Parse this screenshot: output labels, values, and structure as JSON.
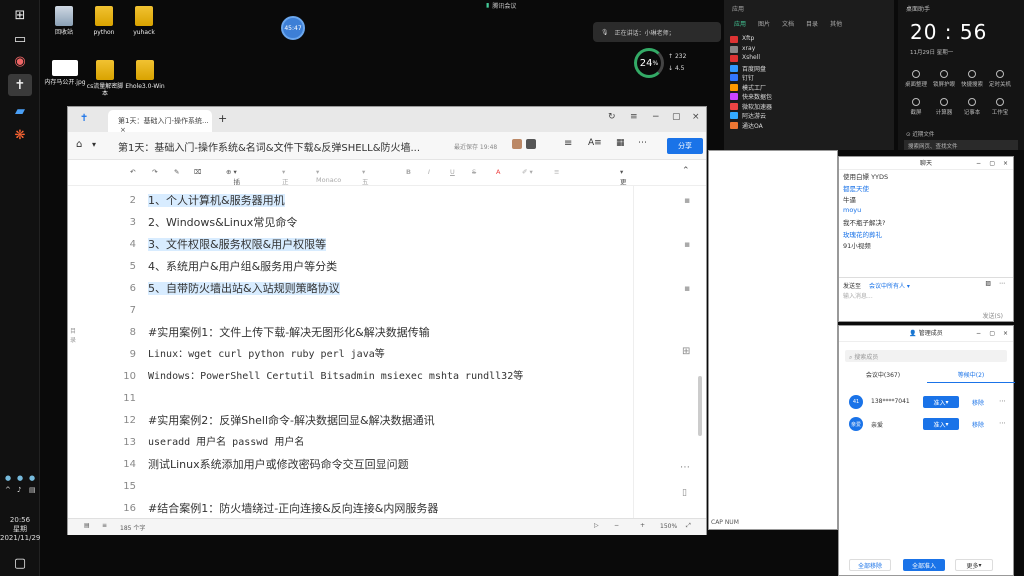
{
  "desktop": {
    "icons": [
      {
        "label": "回收站",
        "kind": "bin"
      },
      {
        "label": "python",
        "kind": "folder"
      },
      {
        "label": "yuhack",
        "kind": "folder"
      },
      {
        "label": "内存马公开.jpg",
        "kind": "image"
      },
      {
        "label": "cs流量解密脚本",
        "kind": "folder"
      },
      {
        "label": "Ehole3.0-Win",
        "kind": "folder"
      }
    ],
    "time_bubble": "45:47",
    "meeting_bar": "腾讯会议",
    "speaking_text": "正在讲话：小琳老师；",
    "net_speed": {
      "percent": "24",
      "unit": "%",
      "up": "232",
      "down": "4.5"
    }
  },
  "taskbar": {
    "clock_time": "20:56",
    "clock_day": "星期",
    "clock_date": "2021/11/29"
  },
  "applist": {
    "header": "应用",
    "tabs": [
      "应用",
      "图片",
      "文档",
      "目录",
      "其他"
    ],
    "items": [
      "Xftp",
      "xray",
      "Xshell",
      "百度网盘",
      "钉钉",
      "模式工厂",
      "快来数据包",
      "微软加速器",
      "阿达游云",
      "通达OA"
    ]
  },
  "control": {
    "title": "桌面助手",
    "time": "20 : 56",
    "date": "11月29日   星期一",
    "quick": [
      "桌面整理",
      "锁屏护眼",
      "快捷搜索",
      "定时关机",
      "截屏",
      "计算器",
      "记事本",
      "工作宝"
    ],
    "recent": "近期文件",
    "search": "搜索网页、查找文件"
  },
  "doc": {
    "tab_title": "第1天：基础入门-操作系统...",
    "title": "第1天：基础入门-操作系统&名词&文件下载&反弹SHELL&防火墙...",
    "saved": "最近保存 19:48",
    "share": "分享",
    "toolbar": [
      "插入",
      "正文",
      "Monaco",
      "五号",
      "B",
      "I",
      "U",
      "S",
      "A",
      "更多"
    ],
    "lines": [
      {
        "n": "2",
        "t": "1、个人计算机&服务器用机"
      },
      {
        "n": "3",
        "t": "2、Windows&Linux常见命令"
      },
      {
        "n": "4",
        "t": "3、文件权限&服务权限&用户权限等"
      },
      {
        "n": "5",
        "t": "4、系统用户&用户组&服务用户等分类"
      },
      {
        "n": "6",
        "t": "5、自带防火墙出站&入站规则策略协议"
      },
      {
        "n": "7",
        "t": ""
      },
      {
        "n": "8",
        "t": "#实用案例1：文件上传下载-解决无图形化&解决数据传输"
      },
      {
        "n": "9",
        "t": "Linux：wget curl python ruby perl java等"
      },
      {
        "n": "10",
        "t": "Windows：PowerShell Certutil Bitsadmin msiexec mshta rundll32等"
      },
      {
        "n": "11",
        "t": ""
      },
      {
        "n": "12",
        "t": "#实用案例2：反弹Shell命令-解决数据回显&解决数据通讯"
      },
      {
        "n": "13",
        "t": "useradd 用户名 passwd 用户名"
      },
      {
        "n": "14",
        "t": "测试Linux系统添加用户或修改密码命令交互回显问题"
      },
      {
        "n": "15",
        "t": ""
      },
      {
        "n": "16",
        "t": "#结合案例1：防火墙绕过-正向连接&反向连接&内网服务器"
      }
    ],
    "char_count": "185 个字",
    "zoom": "150%"
  },
  "chat": {
    "title": "聊天",
    "messages": [
      {
        "text": "使用白嫖 YYDS",
        "name": false
      },
      {
        "text": "都是天使",
        "name": true
      },
      {
        "text": "牛逼",
        "name": false
      },
      {
        "text": "moyu",
        "name": true
      },
      {
        "text": "我不瓶子解决?",
        "name": false
      },
      {
        "text": "玫瑰花的葬礼",
        "name": true
      },
      {
        "text": "91小视频",
        "name": false
      }
    ],
    "send_to_label": "发送至",
    "send_to": "会议中所有人",
    "input_placeholder": "输入消息...",
    "send": "发送(S)"
  },
  "members": {
    "title": "管理成员",
    "search": "搜索成员",
    "tab_in": "会议中(367)",
    "tab_wait": "等候中(2)",
    "rows": [
      {
        "avatar": "41",
        "name": "138****7041",
        "admit": "准入",
        "remove": "移除"
      },
      {
        "avatar": "亲爱",
        "name": "亲爱",
        "admit": "准入",
        "remove": "移除"
      }
    ],
    "remove_all": "全部移除",
    "admit_all": "全部准入",
    "more": "更多"
  },
  "mid_status": "CAP  NUM"
}
